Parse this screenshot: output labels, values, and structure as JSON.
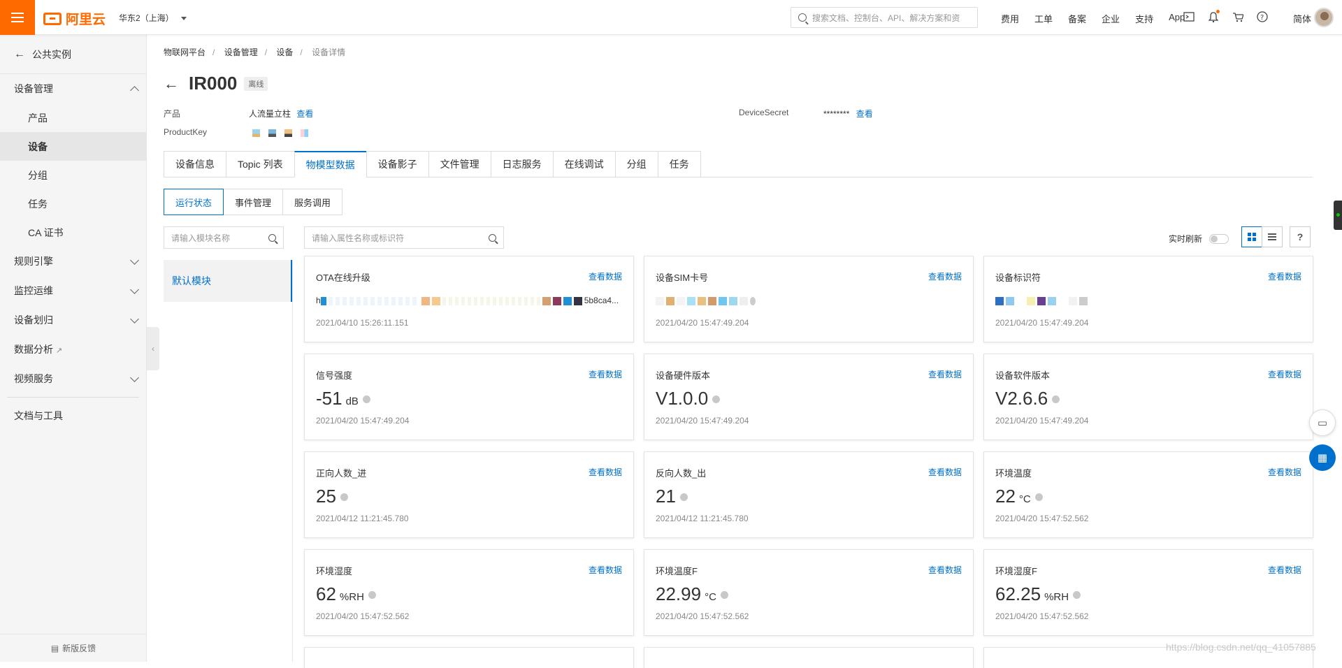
{
  "topbar": {
    "logo": "阿里云",
    "region": "华东2（上海）",
    "search_placeholder": "搜索文档、控制台、API、解决方案和资",
    "links": [
      "费用",
      "工单",
      "备案",
      "企业",
      "支持",
      "App"
    ],
    "icons": [
      "terminal-icon",
      "bell-icon",
      "cart-icon",
      "help-icon"
    ],
    "lang": "简体"
  },
  "sidebar": {
    "back": "公共实例",
    "group_device": "设备管理",
    "items": [
      "产品",
      "设备",
      "分组",
      "任务",
      "CA 证书"
    ],
    "groups": [
      "规则引擎",
      "监控运维",
      "设备划归",
      "数据分析",
      "视频服务"
    ],
    "docs": "文档与工具",
    "feedback": "新版反馈"
  },
  "breadcrumb": [
    "物联网平台",
    "设备管理",
    "设备",
    "设备详情"
  ],
  "device": {
    "name": "IR000",
    "status": "离线",
    "product_label": "产品",
    "product_value": "人流量立柱",
    "view": "查看",
    "productkey_label": "ProductKey",
    "secret_label": "DeviceSecret",
    "secret_value": "********"
  },
  "tabs": [
    "设备信息",
    "Topic 列表",
    "物模型数据",
    "设备影子",
    "文件管理",
    "日志服务",
    "在线调试",
    "分组",
    "任务"
  ],
  "subtabs": [
    "运行状态",
    "事件管理",
    "服务调用"
  ],
  "module_search_placeholder": "请输入模块名称",
  "prop_search_placeholder": "请输入属性名称或标识符",
  "module": "默认模块",
  "realtime_label": "实时刷新",
  "view_data": "查看数据",
  "cards": [
    {
      "name": "OTA在线升级",
      "value": "h",
      "tail": "5b8ca4...",
      "unit": "",
      "time": "2021/04/10 15:26:11.151"
    },
    {
      "name": "设备SIM卡号",
      "value": "",
      "unit": "",
      "time": "2021/04/20 15:47:49.204"
    },
    {
      "name": "设备标识符",
      "value": "",
      "unit": "",
      "time": "2021/04/20 15:47:49.204"
    },
    {
      "name": "信号强度",
      "value": "-51",
      "unit": "dB",
      "time": "2021/04/20 15:47:49.204"
    },
    {
      "name": "设备硬件版本",
      "value": "V1.0.0",
      "unit": "",
      "time": "2021/04/20 15:47:49.204"
    },
    {
      "name": "设备软件版本",
      "value": "V2.6.6",
      "unit": "",
      "time": "2021/04/20 15:47:49.204"
    },
    {
      "name": "正向人数_进",
      "value": "25",
      "unit": "",
      "time": "2021/04/12 11:21:45.780"
    },
    {
      "name": "反向人数_出",
      "value": "21",
      "unit": "",
      "time": "2021/04/12 11:21:45.780"
    },
    {
      "name": "环境温度",
      "value": "22",
      "unit": "°C",
      "time": "2021/04/20 15:47:52.562"
    },
    {
      "name": "环境湿度",
      "value": "62",
      "unit": "%RH",
      "time": "2021/04/20 15:47:52.562"
    },
    {
      "name": "环境温度F",
      "value": "22.99",
      "unit": "°C",
      "time": "2021/04/20 15:47:52.562"
    },
    {
      "name": "环境湿度F",
      "value": "62.25",
      "unit": "%RH",
      "time": "2021/04/20 15:47:52.562"
    }
  ],
  "watermark": "https://blog.csdn.net/qq_41057885"
}
